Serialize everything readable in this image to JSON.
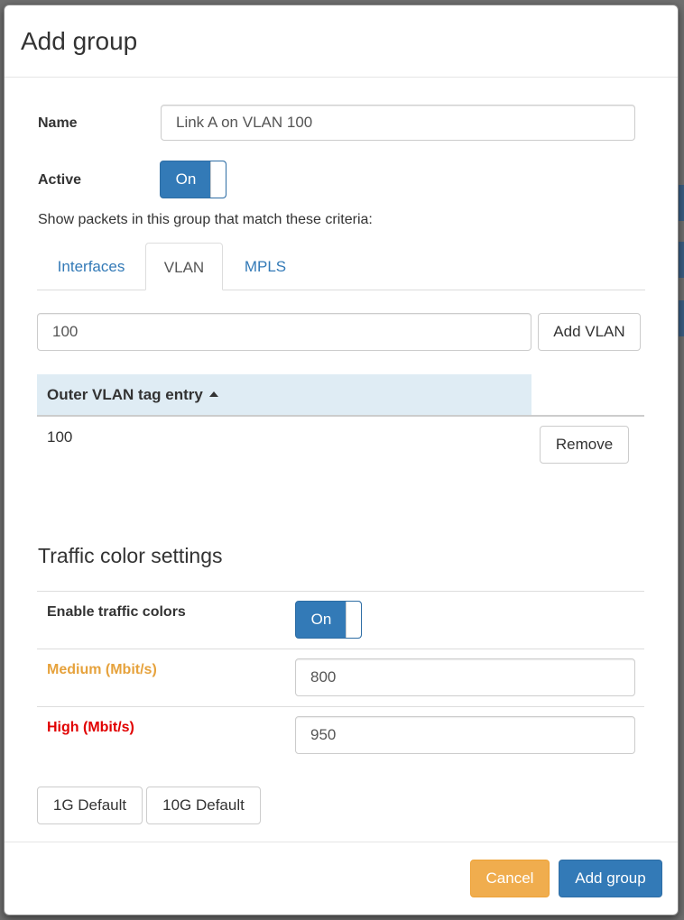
{
  "modal": {
    "title": "Add group"
  },
  "form": {
    "name_label": "Name",
    "name_value": "Link A on VLAN 100",
    "active_label": "Active",
    "active_toggle": "On",
    "criteria_text": "Show packets in this group that match these criteria:"
  },
  "tabs": [
    {
      "label": "Interfaces",
      "active": false
    },
    {
      "label": "VLAN",
      "active": true
    },
    {
      "label": "MPLS",
      "active": false
    }
  ],
  "vlan": {
    "input_value": "100",
    "add_button": "Add VLAN",
    "table_header": "Outer VLAN tag entry",
    "rows": [
      {
        "value": "100",
        "action": "Remove"
      }
    ]
  },
  "traffic": {
    "section_title": "Traffic color settings",
    "enable_label": "Enable traffic colors",
    "enable_toggle": "On",
    "medium_label": "Medium (Mbit/s)",
    "medium_value": "800",
    "high_label": "High (Mbit/s)",
    "high_value": "950",
    "default_1g": "1G Default",
    "default_10g": "10G Default"
  },
  "footer": {
    "cancel": "Cancel",
    "submit": "Add group"
  },
  "colors": {
    "primary": "#337ab7",
    "warning": "#f0ad4e",
    "medium": "#e6a23c",
    "high": "#e10000",
    "table_header_bg": "#dfecf4"
  }
}
